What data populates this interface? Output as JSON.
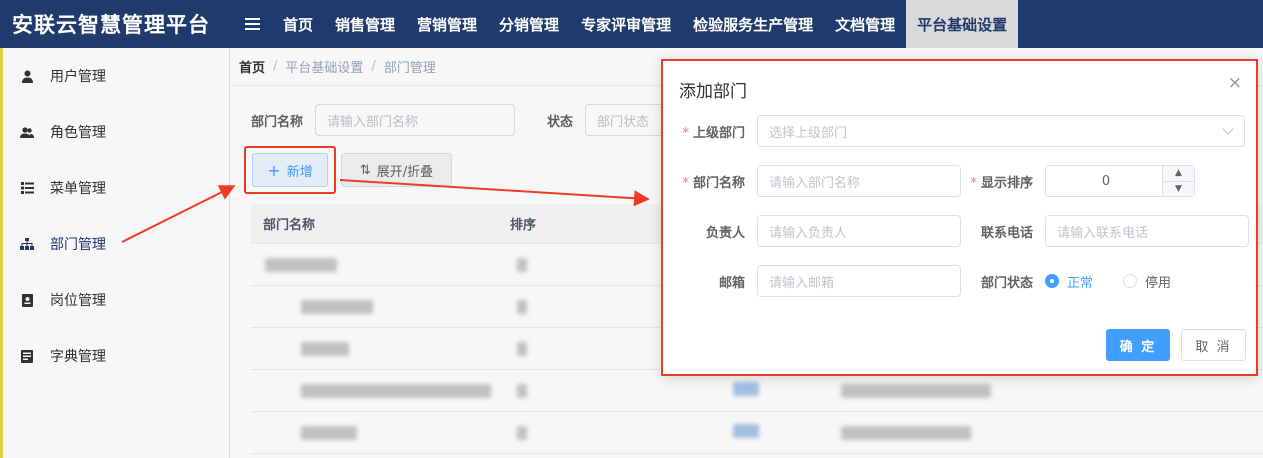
{
  "app": {
    "title": "安联云智慧管理平台"
  },
  "nav": {
    "items": [
      {
        "label": "首页"
      },
      {
        "label": "销售管理"
      },
      {
        "label": "营销管理"
      },
      {
        "label": "分销管理"
      },
      {
        "label": "专家评审管理"
      },
      {
        "label": "检验服务生产管理"
      },
      {
        "label": "文档管理"
      },
      {
        "label": "平台基础设置",
        "active": true
      }
    ]
  },
  "sidebar": {
    "items": [
      {
        "label": "用户管理",
        "icon": "user-icon"
      },
      {
        "label": "角色管理",
        "icon": "users-icon"
      },
      {
        "label": "菜单管理",
        "icon": "list-icon"
      },
      {
        "label": "部门管理",
        "icon": "sitemap-icon",
        "active": true
      },
      {
        "label": "岗位管理",
        "icon": "id-card-icon"
      },
      {
        "label": "字典管理",
        "icon": "book-icon"
      }
    ]
  },
  "breadcrumb": {
    "home": "首页",
    "level1": "平台基础设置",
    "level2": "部门管理",
    "sep": "/"
  },
  "filter": {
    "dept_name_label": "部门名称",
    "dept_name_placeholder": "请输入部门名称",
    "status_label": "状态",
    "status_placeholder": "部门状态"
  },
  "toolbar": {
    "add_label": "新增",
    "add_icon": "+",
    "expand_label": "展开/折叠",
    "expand_icon": "⇅"
  },
  "table": {
    "columns": [
      "部门名称",
      "排序"
    ]
  },
  "dialog": {
    "title": "添加部门",
    "close": "×",
    "parent_label": "上级部门",
    "parent_placeholder": "选择上级部门",
    "name_label": "部门名称",
    "name_placeholder": "请输入部门名称",
    "order_label": "显示排序",
    "order_value": "0",
    "leader_label": "负责人",
    "leader_placeholder": "请输入负责人",
    "phone_label": "联系电话",
    "phone_placeholder": "请输入联系电话",
    "email_label": "邮箱",
    "email_placeholder": "请输入邮箱",
    "status_label": "部门状态",
    "status_options": [
      {
        "label": "正常",
        "selected": true
      },
      {
        "label": "停用",
        "selected": false
      }
    ],
    "required_mark": "*",
    "ok_label": "确 定",
    "cancel_label": "取 消"
  },
  "colors": {
    "header_bg": "#1f3a6d",
    "primary": "#409eff",
    "annotation_red": "#f23b27"
  }
}
